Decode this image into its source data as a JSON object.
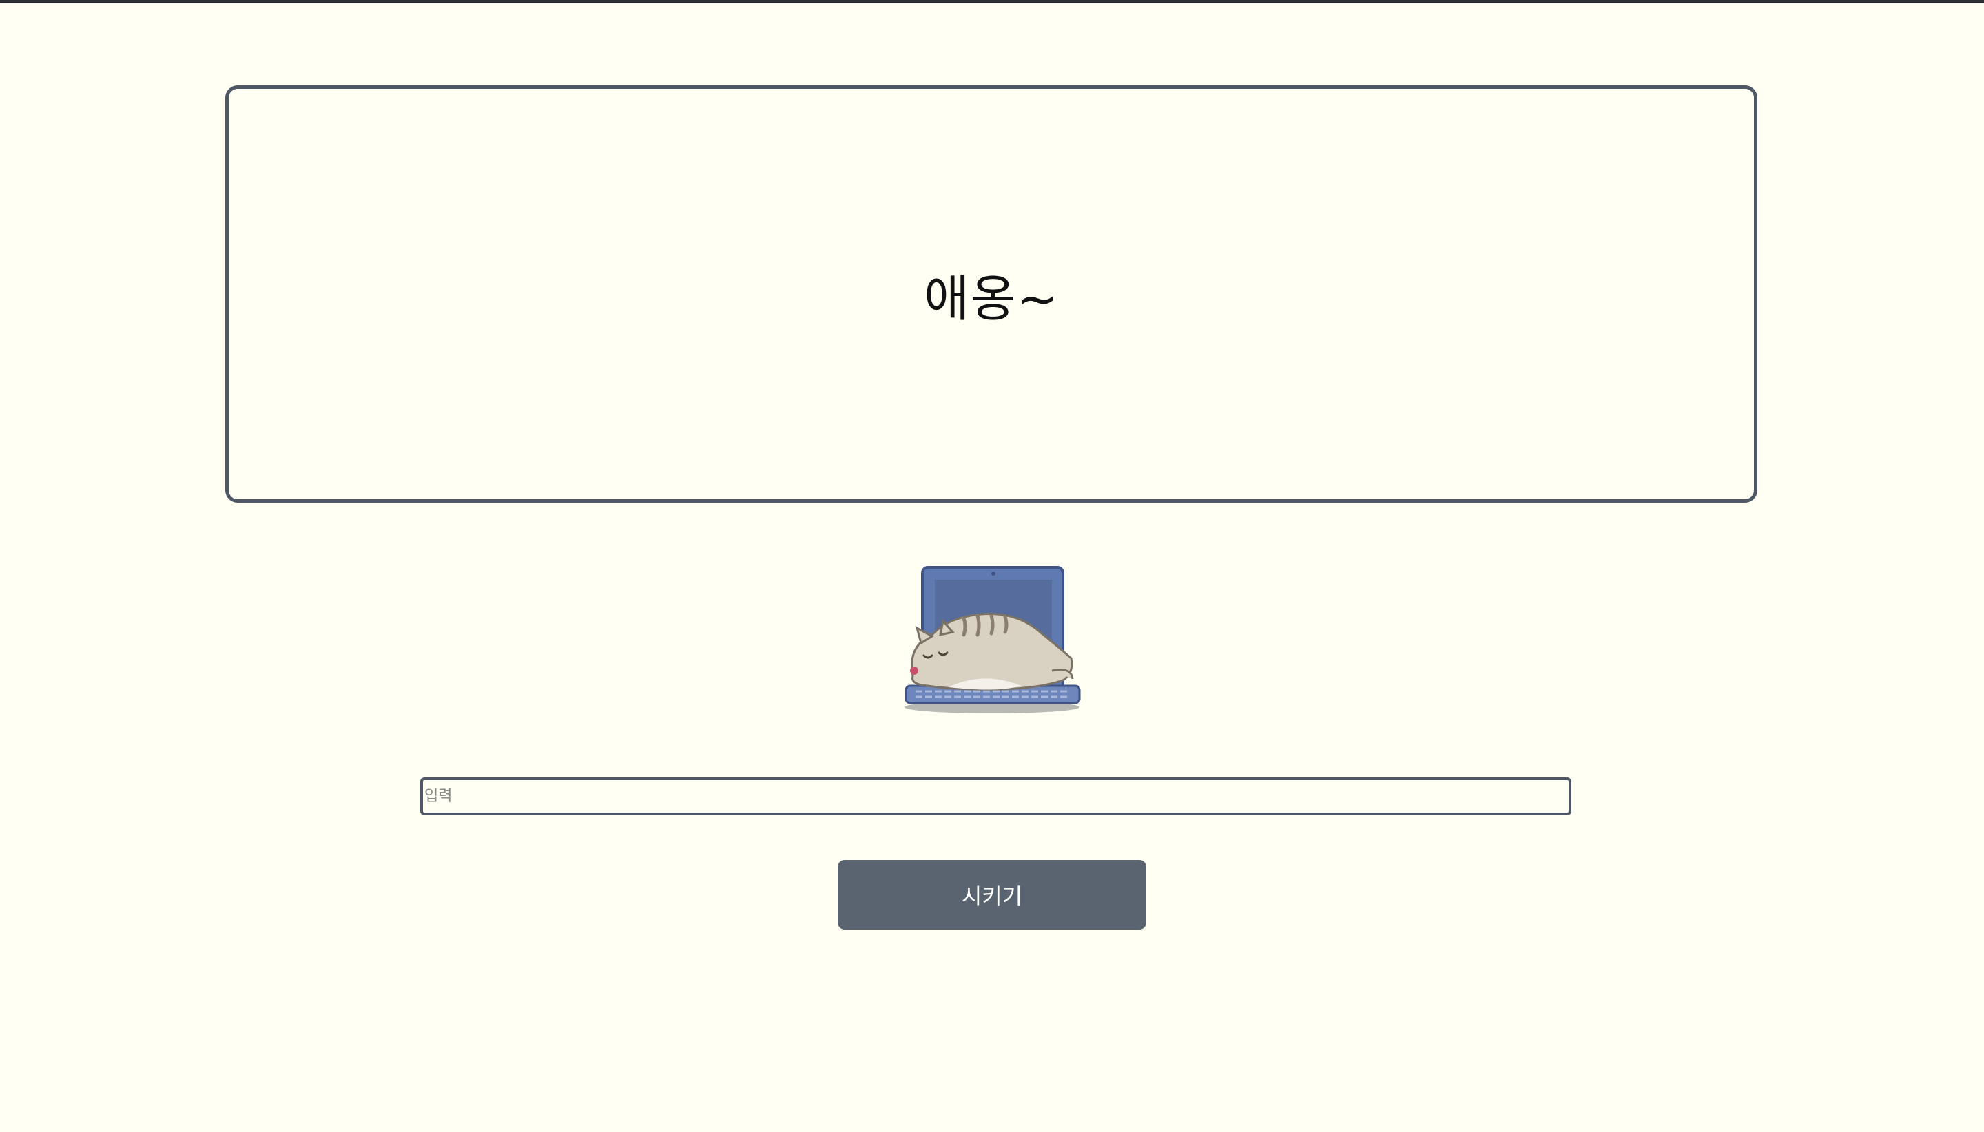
{
  "message": {
    "text": "애옹~"
  },
  "illustration": {
    "icon": "sleeping-cat-on-laptop-icon"
  },
  "input": {
    "placeholder": "입력",
    "value": ""
  },
  "button": {
    "label": "시키기"
  },
  "colors": {
    "background": "#fffff3",
    "border": "#4f5866",
    "button_bg": "#5a6370",
    "button_text": "#ffffff"
  }
}
